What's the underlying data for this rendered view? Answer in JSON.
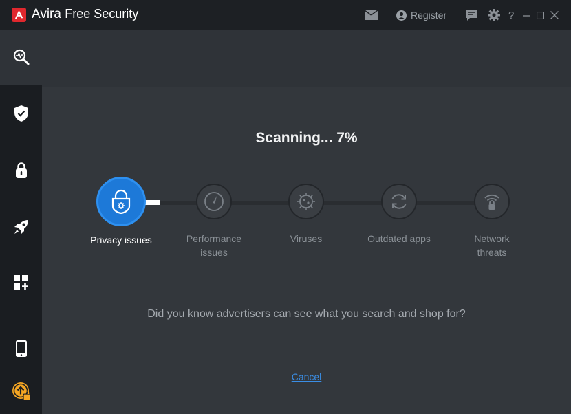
{
  "app": {
    "brand": "Avira",
    "product": "Free Security"
  },
  "header": {
    "register_label": "Register"
  },
  "scan": {
    "title": "Scanning... 7%",
    "progress_percent": 7
  },
  "steps": [
    {
      "label": "Privacy issues",
      "icon": "privacy-lock-icon",
      "active": true
    },
    {
      "label": "Performance issues",
      "icon": "speedometer-icon",
      "active": false
    },
    {
      "label": "Viruses",
      "icon": "virus-icon",
      "active": false
    },
    {
      "label": "Outdated apps",
      "icon": "refresh-icon",
      "active": false
    },
    {
      "label": "Network threats",
      "icon": "wifi-lock-icon",
      "active": false
    }
  ],
  "tip": "Did you know advertisers can see what you search and shop for?",
  "cancel_label": "Cancel",
  "sidebar": [
    "scan-icon",
    "shield-icon",
    "lock-icon",
    "rocket-icon",
    "apps-plus-icon",
    "phone-icon",
    "upgrade-icon"
  ],
  "colors": {
    "accent": "#1d79d8",
    "brand_red": "#e0282e",
    "upgrade": "#f5a623",
    "link": "#3a8ee6"
  }
}
